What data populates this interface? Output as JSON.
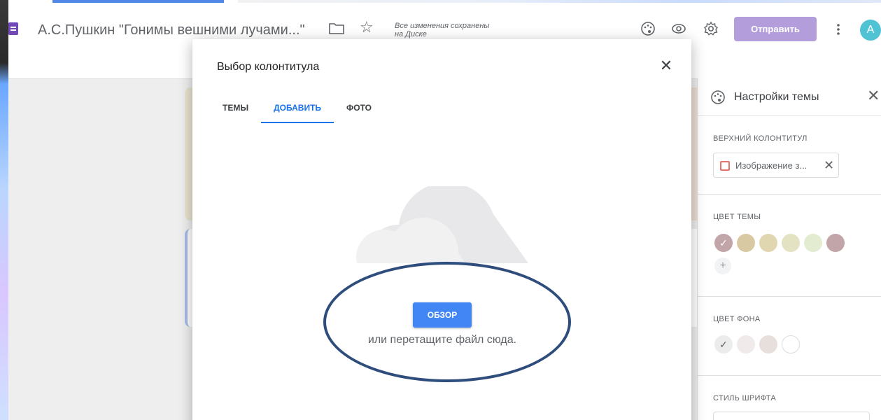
{
  "app": {
    "doc_title": "А.С.Пушкин \"Гонимы вешними лучами...\"",
    "save_status_line1": "Все изменения сохранены",
    "save_status_line2": "на Диске",
    "send_label": "Отправить",
    "avatar_letter": "A"
  },
  "dialog": {
    "title": "Выбор колонтитула",
    "tabs": [
      {
        "label": "ТЕМЫ",
        "active": false
      },
      {
        "label": "ДОБАВИТЬ",
        "active": true
      },
      {
        "label": "ФОТО",
        "active": false
      }
    ],
    "browse_label": "ОБЗОР",
    "drop_text": "или перетащите файл сюда."
  },
  "side_panel": {
    "title": "Настройки темы",
    "header_section": {
      "label": "ВЕРХНИЙ КОЛОНТИТУЛ",
      "chip_label": "Изображение з..."
    },
    "theme_color": {
      "label": "ЦВЕТ ТЕМЫ",
      "swatches": [
        "#c1a5a8",
        "#d8c9a3",
        "#e0d7b0",
        "#e3e3c3",
        "#e3ecd0",
        "#c1a5a8"
      ],
      "selected": 0
    },
    "background_color": {
      "label": "ЦВЕТ ФОНА",
      "swatches": [
        "#ececec",
        "#f0eaea",
        "#e6dfdc",
        "#ffffff"
      ],
      "selected": 0
    },
    "font_style": {
      "label": "СТИЛЬ ШРИФТА"
    }
  },
  "colors": {
    "accent": "#1a73e8",
    "send_button": "#b39ddb",
    "browse_button": "#4285f4",
    "annotation_ellipse": "#2f4d7c"
  },
  "icons": [
    "forms-icon",
    "folder-icon",
    "star-icon",
    "palette-icon",
    "eye-icon",
    "gear-icon",
    "more-vert-icon",
    "close-icon",
    "cloud-icon",
    "image-icon",
    "check-icon",
    "plus-icon"
  ]
}
